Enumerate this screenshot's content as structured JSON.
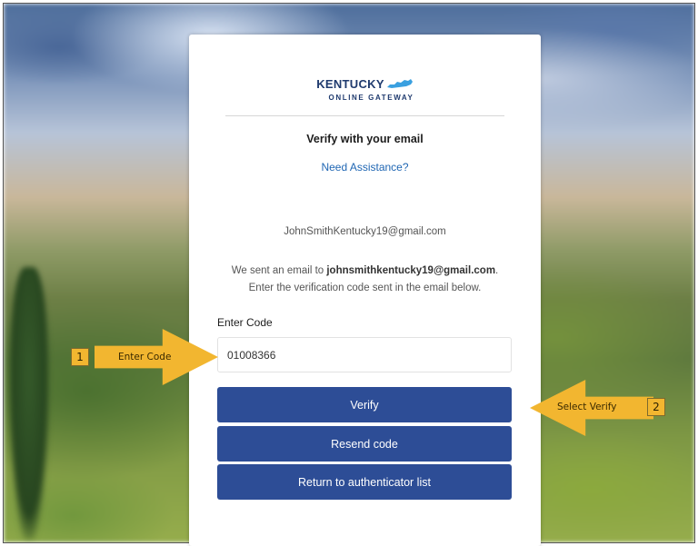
{
  "logo": {
    "main": "KENTUCKY",
    "sub": "ONLINE GATEWAY"
  },
  "page": {
    "title": "Verify with your email",
    "assistance_link": "Need Assistance?"
  },
  "email_display": "JohnSmithKentucky19@gmail.com",
  "message": {
    "prefix": "We sent an email to ",
    "email_bold": "johnsmithkentucky19@gmail.com",
    "suffix": ".",
    "line2": "Enter the verification code sent in the email below."
  },
  "code_field": {
    "label": "Enter Code",
    "value": "01008366"
  },
  "buttons": {
    "verify": "Verify",
    "resend": "Resend code",
    "return": "Return to authenticator list"
  },
  "annotations": {
    "step1_number": "1",
    "step1_text": "Enter Code",
    "step2_number": "2",
    "step2_text": "Select Verify",
    "color": "#f2b630"
  },
  "colors": {
    "button": "#2d4d96",
    "link": "#1f66b3",
    "logo": "#1f3a6e"
  }
}
